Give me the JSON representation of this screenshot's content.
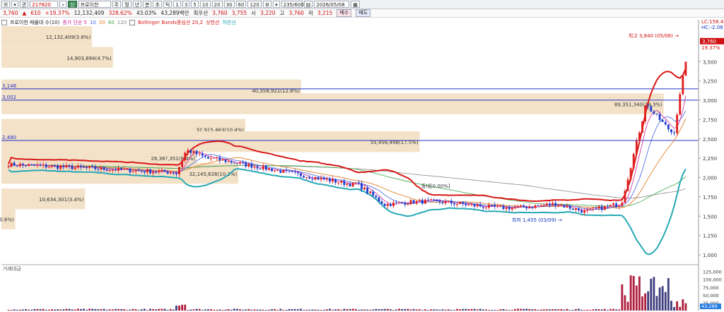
{
  "toolbar": {
    "code": "217820",
    "stock_name": "프로이천",
    "period_buttons": [
      "주",
      "월",
      "년",
      "분",
      "초",
      "틱"
    ],
    "interval_buttons": [
      "1",
      "3",
      "5",
      "10",
      "20",
      "30",
      "60",
      "120"
    ],
    "count": "235/600",
    "date": "2026/05/08"
  },
  "info": {
    "price": "3,760",
    "change": "610",
    "change_pct": "+19.37%",
    "volume": "12,132,409",
    "vol_ratio": "328.62%",
    "turnover": "43.03%",
    "amount": "43,289백만",
    "pref_label": "최우선",
    "ask": "3,760",
    "bid": "3,755",
    "open_label": "시",
    "open": "3,220",
    "high_label": "고",
    "high": "3,760",
    "low_label": "저",
    "low": "3,215",
    "buy_btn": "매수",
    "sell_btn": "매도"
  },
  "legend": {
    "main": "프로이천 매물대 수(10)",
    "ma": "종가 단순 5",
    "ma_periods": [
      "10",
      "20",
      "60",
      "120"
    ],
    "bb": "Bollinger Bands중심선 20,2",
    "bb_upper": "상한선",
    "bb_lower": "하한선"
  },
  "volume_panel_label": "거래대금",
  "colors": {
    "candle_up": "#e02020",
    "candle_down": "#1f3fd0",
    "bb_upper": "#d81818",
    "bb_lower": "#27a9b5",
    "ma5": "#d0249c",
    "ma10": "#4060e0",
    "ma20": "#e0802a",
    "ma60": "#3aa84a",
    "ma120": "#888888",
    "profile": "#f3e2c8"
  },
  "chart_data": {
    "type": "candlestick",
    "ylim": [
      900,
      3950
    ],
    "y_ticks": [
      "1,000",
      "1,250",
      "1,500",
      "1,750",
      "2,000",
      "2,250",
      "2,500",
      "2,750",
      "3,000",
      "3,250",
      "3,500"
    ],
    "y_tick_values": [
      1000,
      1250,
      1500,
      1750,
      2000,
      2250,
      2500,
      2750,
      3000,
      3250,
      3500
    ],
    "right_labels": {
      "lc": "LC:158.42",
      "hc": "HC:-2.08",
      "last_price": "3,760",
      "last_pct": "19.37%"
    },
    "volume_profile": [
      {
        "price": 3820,
        "label": "12,132,409(3.8%)",
        "length": 0.13
      },
      {
        "price": 3550,
        "label": "14,903,894(4.7%)",
        "length": 0.16
      },
      {
        "price": 3130,
        "label": "40,358,921(12.8%)",
        "length": 0.43
      },
      {
        "price": 2950,
        "label": "89,351,340(28.3%)",
        "length": 0.95
      },
      {
        "price": 2620,
        "label": "32,915,463(10.4%)",
        "length": 0.35
      },
      {
        "price": 2460,
        "label": "55,456,498(17.5%)",
        "length": 0.6
      },
      {
        "price": 2250,
        "label": "26,36?,351(8.4%)",
        "length": 0.28
      },
      {
        "price": 2050,
        "label": "32,145,626(10.2%)",
        "length": 0.34
      },
      {
        "price": 1720,
        "label": "10,634,301(3.4%)",
        "length": 0.12
      },
      {
        "price": 1460,
        "label": "1,786,644(0.6%)",
        "length": 0.02
      }
    ],
    "hlines": [
      {
        "price": 3148,
        "label": "3,148"
      },
      {
        "price": 3002,
        "label": "3,002"
      },
      {
        "price": 2480,
        "label": "2,480"
      }
    ],
    "annotations": {
      "high_label": "최고 3,840 (05/06)",
      "low_label": "최저 1,455 (03/09)",
      "mid_label": "종대[0.00%]"
    },
    "volume_axis": {
      "ticks": [
        "125,000",
        "100,000",
        "75,000",
        "50,000",
        "25,000"
      ],
      "tick_values": [
        125000,
        100000,
        75000,
        50000,
        25000
      ],
      "last": "43,289",
      "ylim": [
        0,
        140000
      ]
    }
  }
}
